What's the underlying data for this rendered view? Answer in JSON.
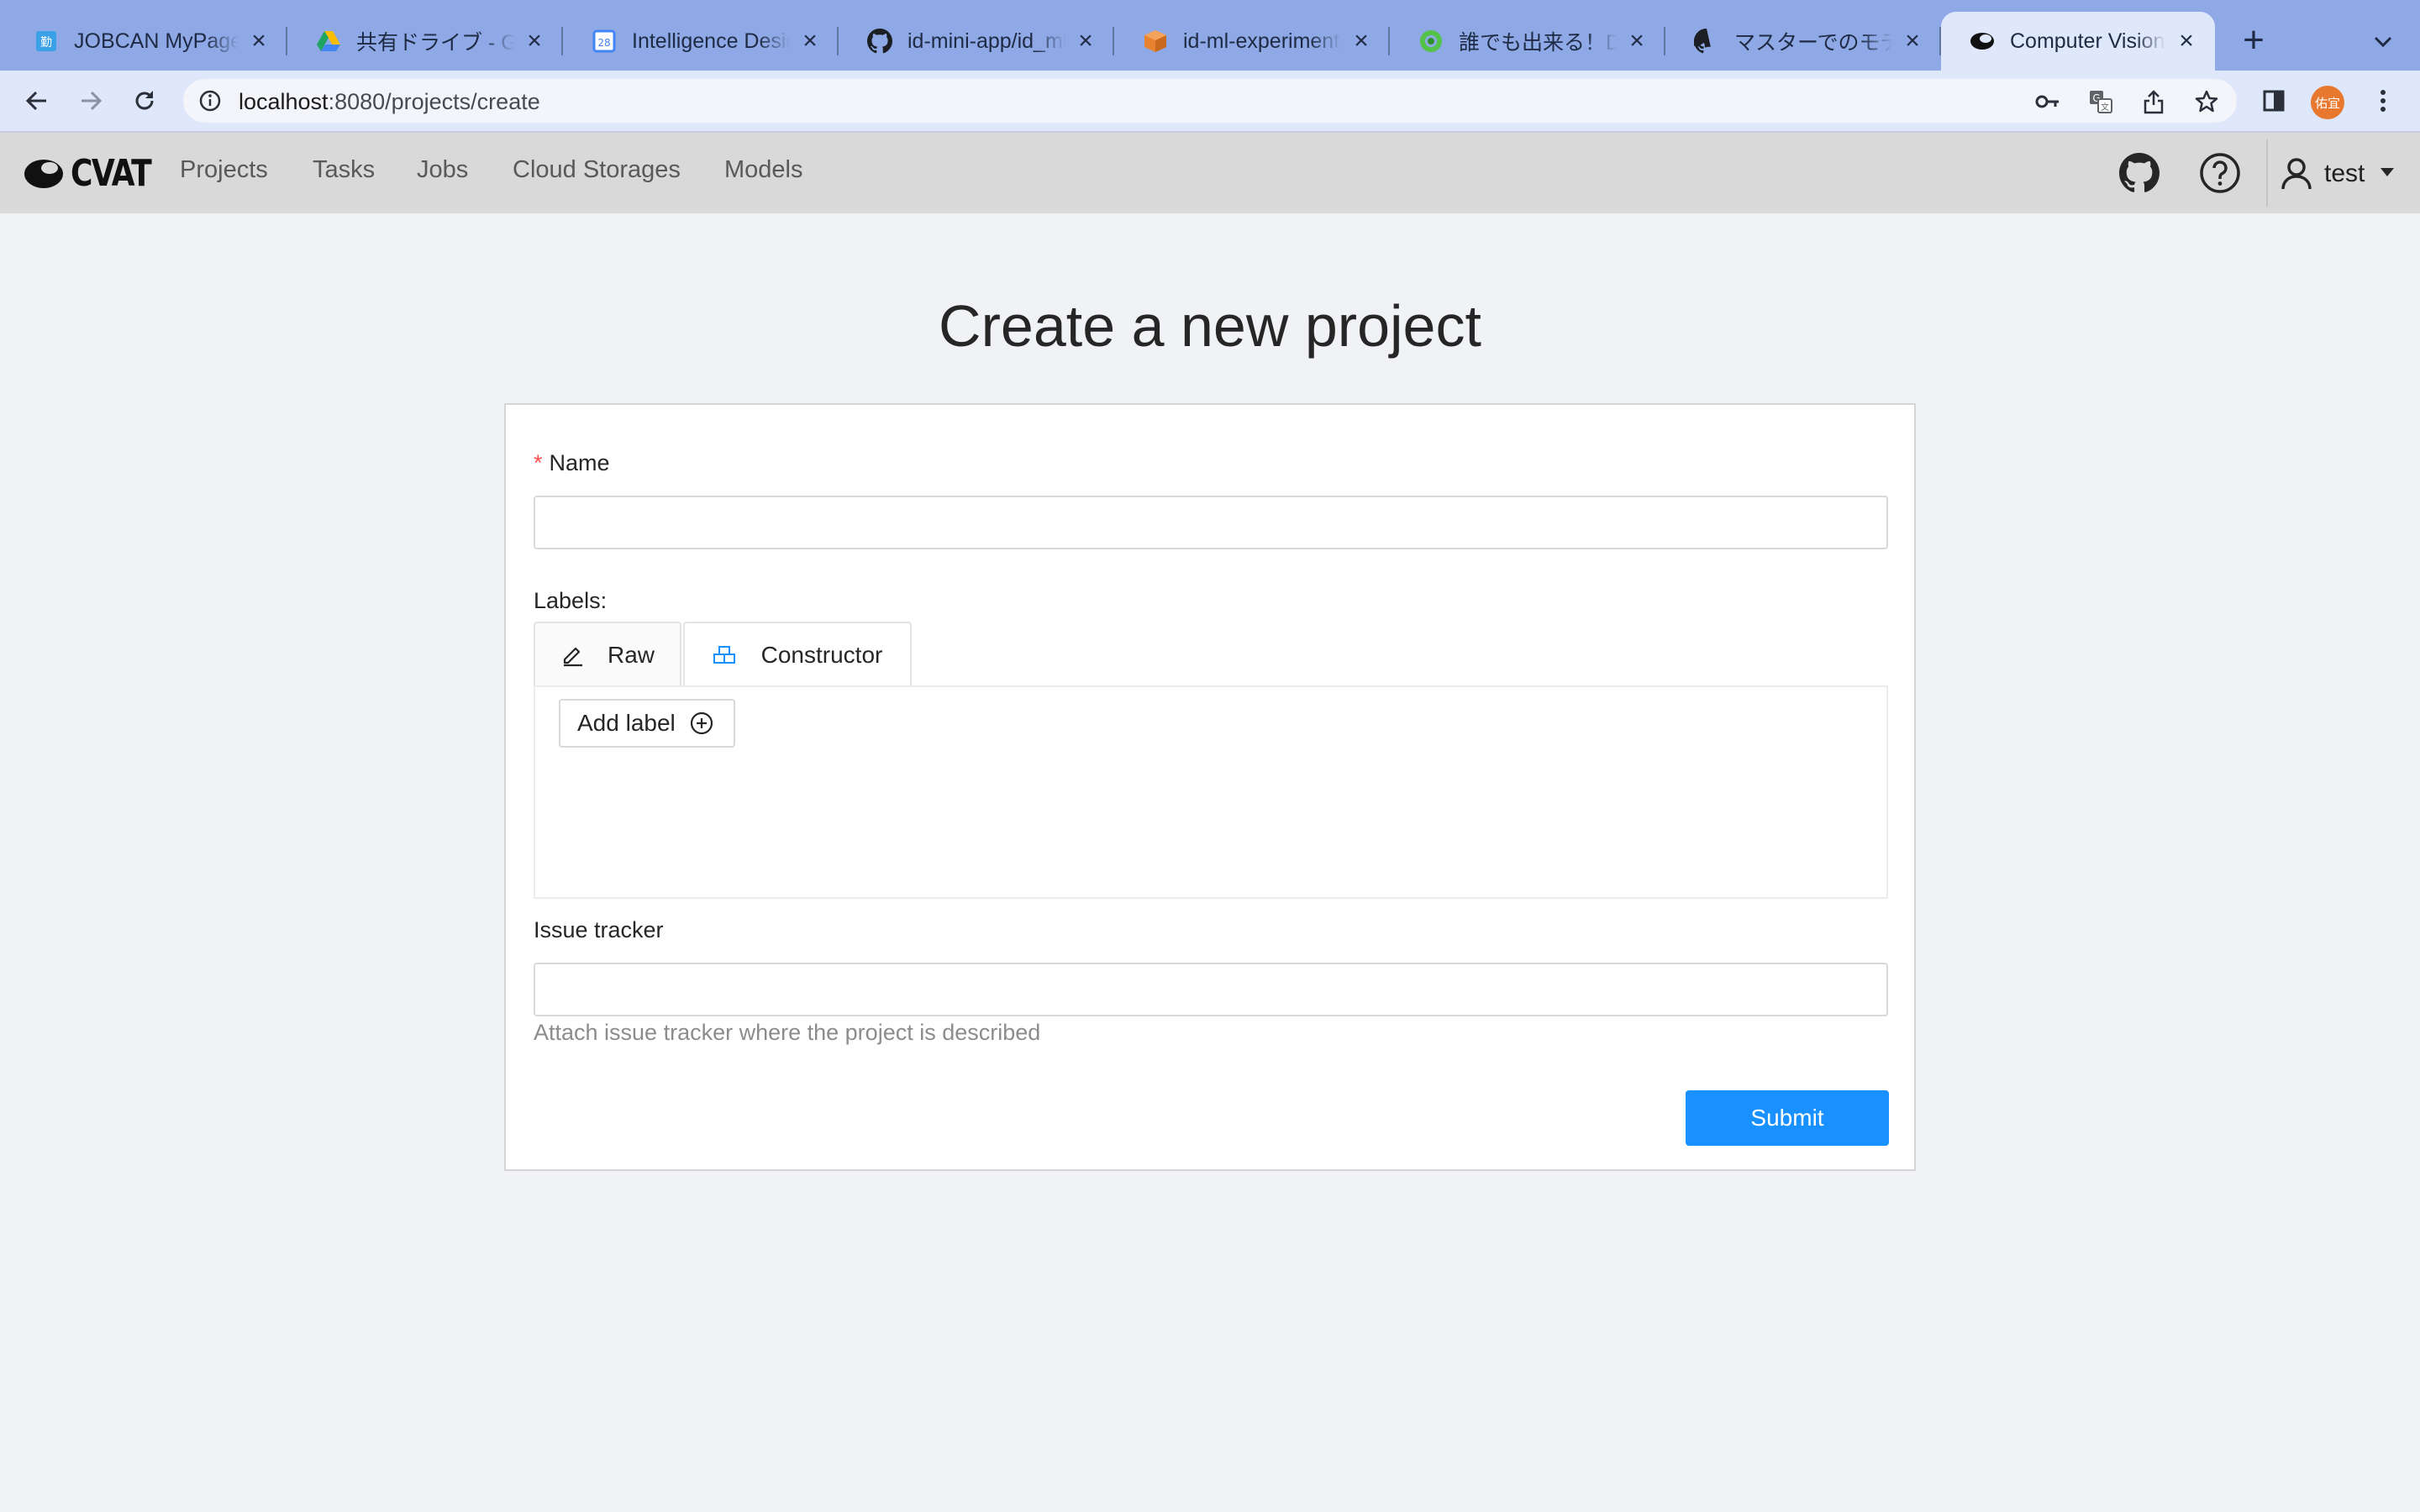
{
  "browser": {
    "tabs": [
      {
        "title": "JOBCAN MyPage",
        "favicon": "jobcan-icon",
        "active": false
      },
      {
        "title": "共有ドライブ - Google ドライブ",
        "favicon": "google-drive-icon",
        "active": false
      },
      {
        "title": "Intelligence Design",
        "favicon": "calendar-icon",
        "active": false
      },
      {
        "title": "id-mini-app/id_ml",
        "favicon": "github-icon",
        "active": false
      },
      {
        "title": "id-ml-experiment",
        "favicon": "package-icon",
        "active": false
      },
      {
        "title": "誰でも出来る！Deep",
        "favicon": "green-circle-icon",
        "active": false
      },
      {
        "title": "マスターでのモデル",
        "favicon": "github-icon",
        "active": false
      },
      {
        "title": "Computer Vision",
        "favicon": "cvat-eye-icon",
        "active": true
      }
    ],
    "url_host": "localhost",
    "url_path": ":8080/projects/create",
    "profile_badge": "佑宜"
  },
  "app": {
    "logo_text": "CVAT",
    "nav": [
      "Projects",
      "Tasks",
      "Jobs",
      "Cloud Storages",
      "Models"
    ],
    "username": "test"
  },
  "page": {
    "title": "Create a new project",
    "name_label": "Name",
    "name_required_mark": "*",
    "name_value": "",
    "labels_heading": "Labels:",
    "label_tabs": [
      {
        "label": "Raw",
        "icon": "edit-icon",
        "active": false
      },
      {
        "label": "Constructor",
        "icon": "build-icon",
        "active": true
      }
    ],
    "add_label_button": "Add label",
    "issue_tracker_label": "Issue tracker",
    "issue_tracker_value": "",
    "issue_tracker_help": "Attach issue tracker where the project is described",
    "submit_button": "Submit"
  },
  "colors": {
    "primary": "#1890ff",
    "required": "#ff4d4f",
    "browser_frame": "#8ea9e5",
    "app_header": "#d9d9d9"
  }
}
